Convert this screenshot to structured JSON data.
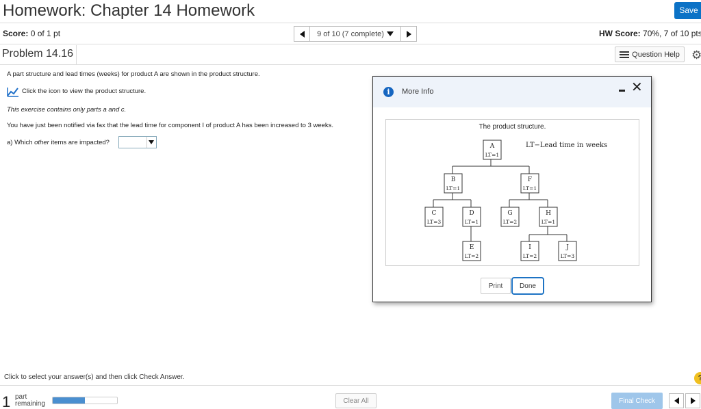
{
  "header": {
    "title": "Homework: Chapter 14 Homework",
    "save_label": "Save"
  },
  "score_bar": {
    "score_label": "Score:",
    "score_value": "0 of 1 pt",
    "nav_label": "9 of 10 (7 complete)",
    "hw_score_label": "HW Score:",
    "hw_score_value": "70%, 7 of 10 pts"
  },
  "problem": {
    "title": "Problem 14.16",
    "question_help_label": "Question Help"
  },
  "question": {
    "intro": "A part structure and lead times (weeks) for product A are shown in the product structure.",
    "click_icon_text": "Click the icon to view the product structure.",
    "parts_note": "This exercise contains only parts a and c.",
    "notification": "You have just been notified via fax that the lead time for component I of product A has been increased to 3 weeks.",
    "part_a_prefix": "a) Which ",
    "part_a_emph": "other",
    "part_a_suffix": " items are impacted?",
    "dropdown_value": ""
  },
  "modal": {
    "title": "More Info",
    "caption": "The product structure.",
    "legend": "LT−Lead time in weeks",
    "nodes": [
      {
        "id": "A",
        "name": "A",
        "lt": "LT=1"
      },
      {
        "id": "B",
        "name": "B",
        "lt": "LT=1"
      },
      {
        "id": "F",
        "name": "F",
        "lt": "LT=1"
      },
      {
        "id": "C",
        "name": "C",
        "lt": "LT=3"
      },
      {
        "id": "D",
        "name": "D",
        "lt": "LT=1"
      },
      {
        "id": "G",
        "name": "G",
        "lt": "LT=2"
      },
      {
        "id": "H",
        "name": "H",
        "lt": "LT=1"
      },
      {
        "id": "E",
        "name": "E",
        "lt": "LT=2"
      },
      {
        "id": "I",
        "name": "I",
        "lt": "LT=2"
      },
      {
        "id": "J",
        "name": "J",
        "lt": "LT=3"
      }
    ],
    "print_label": "Print",
    "done_label": "Done"
  },
  "footer": {
    "instruction": "Click to select your answer(s) and then click Check Answer.",
    "parts_count": "1",
    "parts_label_1": "part",
    "parts_label_2": "remaining",
    "progress_fraction": 0.5,
    "clear_all_label": "Clear All",
    "final_check_label": "Final Check"
  },
  "icons": {
    "chart": "line-chart-icon",
    "info": "info-icon",
    "help": "help-icon",
    "gear": "gear-icon"
  },
  "colors": {
    "accent": "#0b72c6",
    "modal_header": "#eef3fa",
    "final_check": "#9fc6ea"
  }
}
